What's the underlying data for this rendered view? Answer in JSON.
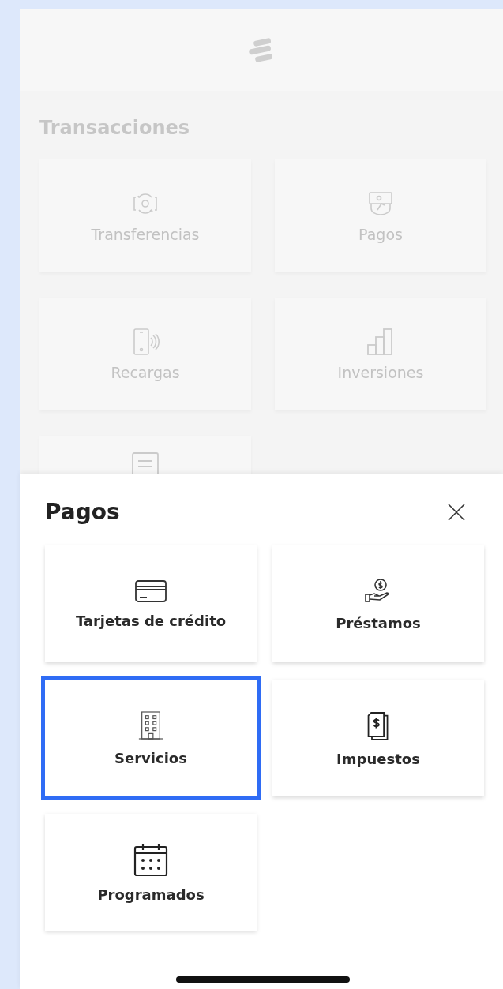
{
  "transactions": {
    "title": "Transacciones",
    "tiles": [
      {
        "label": "Transferencias"
      },
      {
        "label": "Pagos"
      },
      {
        "label": "Recargas"
      },
      {
        "label": "Inversiones"
      },
      {
        "kind": "partial"
      }
    ]
  },
  "sheet": {
    "title": "Pagos",
    "options": [
      {
        "label": "Tarjetas de crédito",
        "selected": false
      },
      {
        "label": "Préstamos",
        "selected": false
      },
      {
        "label": "Servicios",
        "selected": true
      },
      {
        "label": "Impuestos",
        "selected": false
      },
      {
        "label": "Programados",
        "selected": false
      }
    ]
  }
}
